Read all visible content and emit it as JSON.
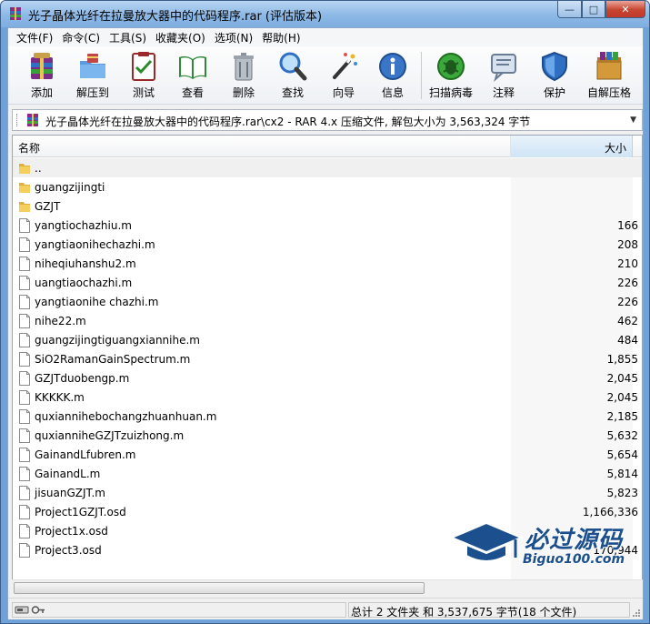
{
  "window": {
    "title": "光子晶体光纤在拉曼放大器中的代码程序.rar (评估版本)",
    "min_glyph": "—",
    "max_glyph": "□",
    "close_glyph": "✕"
  },
  "menu": [
    "文件(F)",
    "命令(C)",
    "工具(S)",
    "收藏夹(O)",
    "选项(N)",
    "帮助(H)"
  ],
  "toolbar": [
    {
      "label": "添加",
      "icon": "add-archive-icon"
    },
    {
      "label": "解压到",
      "icon": "extract-to-icon"
    },
    {
      "label": "测试",
      "icon": "test-icon"
    },
    {
      "label": "查看",
      "icon": "view-book-icon"
    },
    {
      "label": "删除",
      "icon": "trash-icon"
    },
    {
      "label": "查找",
      "icon": "magnifier-icon"
    },
    {
      "label": "向导",
      "icon": "wizard-wand-icon"
    },
    {
      "label": "信息",
      "icon": "info-icon"
    },
    {
      "label": "扫描病毒",
      "icon": "virus-scan-icon"
    },
    {
      "label": "注释",
      "icon": "comment-icon"
    },
    {
      "label": "保护",
      "icon": "shield-icon"
    },
    {
      "label": "自解压格",
      "icon": "sfx-box-icon"
    }
  ],
  "address": {
    "path": "光子晶体光纤在拉曼放大器中的代码程序.rar\\cx2 - RAR 4.x 压缩文件, 解包大小为 3,563,324 字节",
    "dropdown_glyph": "▼"
  },
  "columns": {
    "name": "名称",
    "size": "大小",
    "sort_glyph": "^"
  },
  "files": [
    {
      "name": "..",
      "size": "",
      "type": "up-folder"
    },
    {
      "name": "guangzijingti",
      "size": "",
      "type": "folder"
    },
    {
      "name": "GZJT",
      "size": "",
      "type": "folder"
    },
    {
      "name": "yangtiochazhiu.m",
      "size": "166",
      "type": "file"
    },
    {
      "name": "yangtiaonihechazhi.m",
      "size": "208",
      "type": "file"
    },
    {
      "name": "niheqiuhanshu2.m",
      "size": "210",
      "type": "file"
    },
    {
      "name": "uangtiaochazhi.m",
      "size": "226",
      "type": "file"
    },
    {
      "name": "yangtiaonihe chazhi.m",
      "size": "226",
      "type": "file"
    },
    {
      "name": "nihe22.m",
      "size": "462",
      "type": "file"
    },
    {
      "name": "guangzijingtiguangxiannihe.m",
      "size": "484",
      "type": "file"
    },
    {
      "name": "SiO2RamanGainSpectrum.m",
      "size": "1,855",
      "type": "file"
    },
    {
      "name": "GZJTduobengp.m",
      "size": "2,045",
      "type": "file"
    },
    {
      "name": "KKKKK.m",
      "size": "2,045",
      "type": "file"
    },
    {
      "name": "quxiannihebochangzhuanhuan.m",
      "size": "2,185",
      "type": "file"
    },
    {
      "name": "quxianniheGZJTzuizhong.m",
      "size": "5,632",
      "type": "file"
    },
    {
      "name": "GainandLfubren.m",
      "size": "5,654",
      "type": "file"
    },
    {
      "name": "GainandL.m",
      "size": "5,814",
      "type": "file"
    },
    {
      "name": "jisuanGZJT.m",
      "size": "5,823",
      "type": "file"
    },
    {
      "name": "Project1GZJT.osd",
      "size": "1,166,336",
      "type": "file"
    },
    {
      "name": "Project1x.osd",
      "size": "",
      "type": "file"
    },
    {
      "name": "Project3.osd",
      "size": "170,944",
      "type": "file"
    }
  ],
  "status": {
    "summary": "总计 2 文件夹 和 3,537,675 字节(18 个文件)"
  },
  "watermark": {
    "name": "必过源码",
    "url": "Biguo100.com"
  },
  "colors": {
    "title_bar": "#8db8e6",
    "close_button": "#c8452f",
    "selected_column": "#cfe4f6",
    "folder": "#f0c44c",
    "watermark": "#1b4f8d"
  }
}
